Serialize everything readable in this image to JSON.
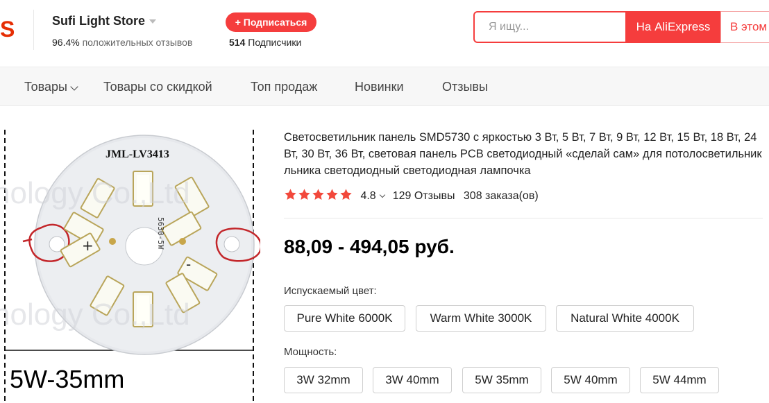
{
  "header": {
    "logo_fragment": "S",
    "store_name": "Sufi Light Store",
    "positive_rating": "96.4%",
    "positive_label": "положительных отзывов",
    "follow_label": "+ Подписаться",
    "followers_count": "514",
    "followers_label": "Подписчики"
  },
  "search": {
    "placeholder": "Я ищу...",
    "btn_aliexpress": "На AliExpress",
    "btn_store": "В этом магазине"
  },
  "nav": {
    "items": [
      {
        "label": "Товары"
      },
      {
        "label": "Товары со скидкой"
      },
      {
        "label": "Топ продаж"
      },
      {
        "label": "Новинки"
      },
      {
        "label": "Отзывы"
      }
    ]
  },
  "product_image": {
    "board_label": "JML-LV3413",
    "watermark": "nology Co.,Ltd",
    "caption": "5W-35mm",
    "plus_mark": "+",
    "minus_mark": "-",
    "chip_text": "5630-5W"
  },
  "product": {
    "title": "Светосветильник панель SMD5730 с яркостью 3 Вт, 5 Вт, 7 Вт, 9 Вт, 12 Вт, 15 Вт, 18 Вт, 24 Вт, 30 Вт, 36 Вт, световая панель PCB светодиодный «сделай сам» для потолосветильник льника светодиодный светодиодная лампочка",
    "rating": "4.8",
    "stars": 5,
    "reviews": "129 Отзывы",
    "orders": "308 заказа(ов)",
    "price": "88,09 - 494,05 руб.",
    "color_label": "Испускаемый цвет:",
    "colors": [
      "Pure White 6000K",
      "Warm White 3000K",
      "Natural White 4000K"
    ],
    "power_label": "Мощность:",
    "powers": [
      "3W 32mm",
      "3W 40mm",
      "5W 35mm",
      "5W 40mm",
      "5W 44mm"
    ]
  },
  "colors": {
    "accent": "#f53d3d",
    "star": "#f2483b"
  }
}
